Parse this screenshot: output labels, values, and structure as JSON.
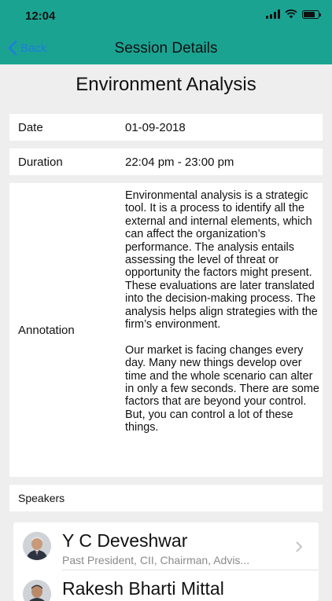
{
  "status": {
    "time": "12:04"
  },
  "nav": {
    "back_label": "Back",
    "title": "Session Details"
  },
  "session": {
    "title": "Environment Analysis",
    "date_label": "Date",
    "date_value": "01-09-2018",
    "duration_label": "Duration",
    "duration_value": "22:04 pm - 23:00 pm",
    "annotation_label": "Annotation",
    "annotation_paragraphs": [
      "Environmental analysis is a strategic tool. It is a process to identify all the external and internal elements, which can affect the organization’s performance. The analysis entails assessing the level of threat or opportunity the factors might present. These evaluations are later translated into the decision-making process. The analysis helps align strategies with the firm’s environment.",
      "Our market is facing changes every day. Many new things develop over time and the whole scenario can alter in only a few seconds. There are some factors that are beyond your control. But, you can control a lot of these things."
    ],
    "speakers_label": "Speakers"
  },
  "speakers": [
    {
      "name": "Y C Deveshwar",
      "subtitle": "Past President, CII, Chairman, Advis..."
    },
    {
      "name": "Rakesh Bharti Mittal",
      "subtitle": ""
    }
  ]
}
